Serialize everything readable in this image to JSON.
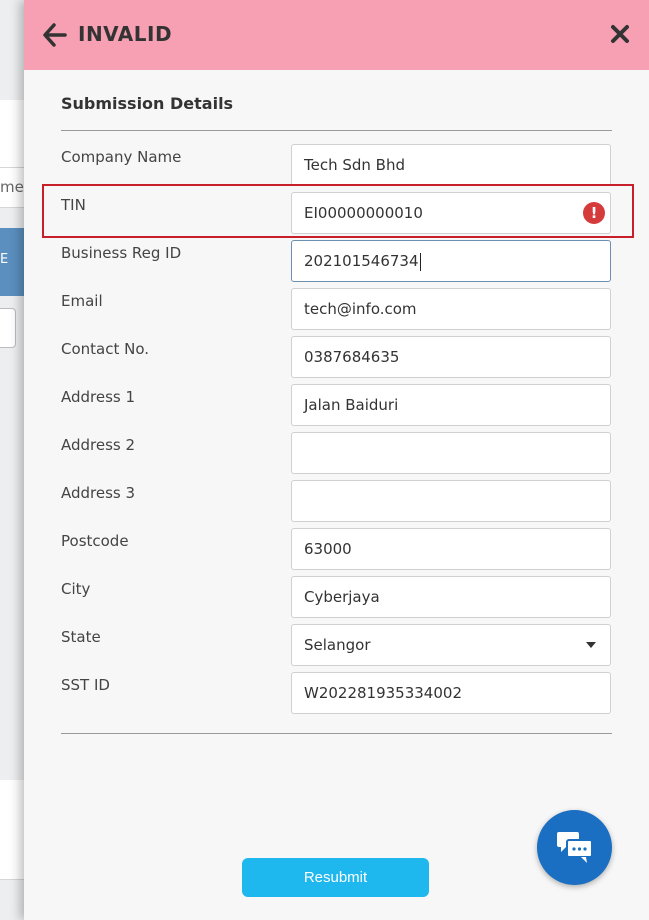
{
  "background": {
    "partial_text": "me",
    "partial_button_text": "E"
  },
  "header": {
    "title": "INVALID",
    "back_icon": "arrow-left-icon",
    "close_icon": "close-icon",
    "color": "#f7a0b3"
  },
  "section": {
    "title": "Submission Details"
  },
  "fields": {
    "company_name": {
      "label": "Company Name",
      "value": "Tech Sdn Bhd"
    },
    "tin": {
      "label": "TIN",
      "value": "EI00000000010",
      "status": "error"
    },
    "business_reg_id": {
      "label": "Business Reg ID",
      "value": "202101546734"
    },
    "email": {
      "label": "Email",
      "value": "tech@info.com"
    },
    "contact_no": {
      "label": "Contact No.",
      "value": "0387684635"
    },
    "address1": {
      "label": "Address 1",
      "value": "Jalan Baiduri"
    },
    "address2": {
      "label": "Address 2",
      "value": ""
    },
    "address3": {
      "label": "Address 3",
      "value": ""
    },
    "postcode": {
      "label": "Postcode",
      "value": "63000"
    },
    "city": {
      "label": "City",
      "value": "Cyberjaya"
    },
    "state": {
      "label": "State",
      "value": "Selangor"
    },
    "sst_id": {
      "label": "SST ID",
      "value": "W202281935334002"
    }
  },
  "actions": {
    "resubmit_label": "Resubmit",
    "resubmit_color": "#1eb8ee"
  },
  "chat": {
    "icon": "chat-icon",
    "color": "#1a6fc2"
  },
  "error": {
    "icon_glyph": "!",
    "color": "#d63b3b"
  }
}
